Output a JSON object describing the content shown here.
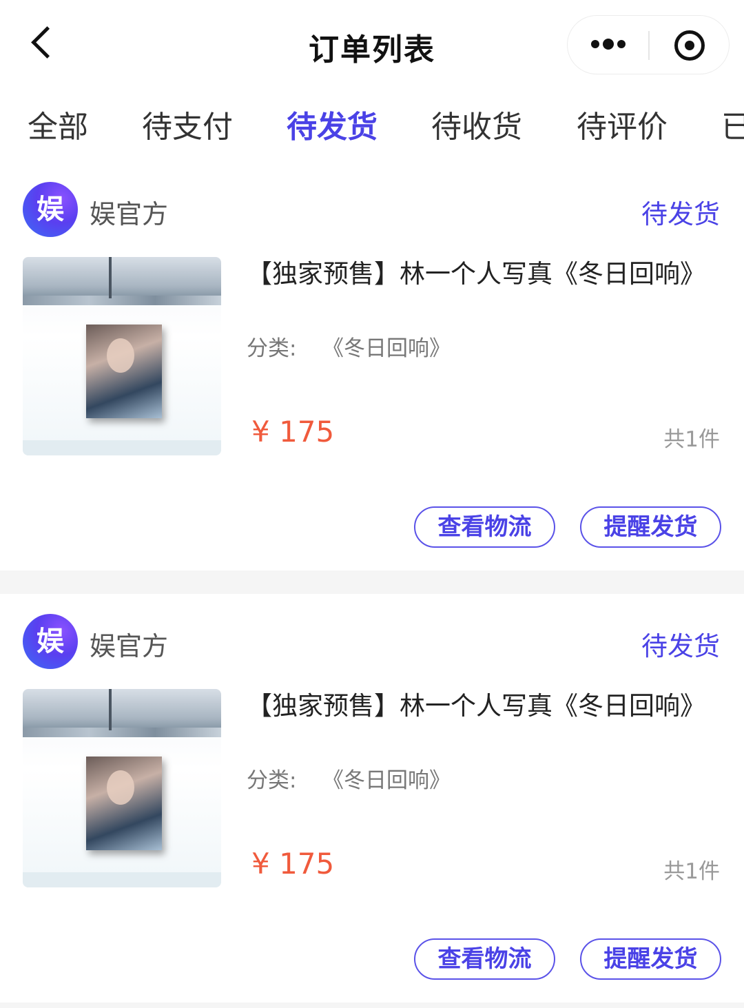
{
  "nav": {
    "title": "订单列表"
  },
  "tabs": [
    {
      "label": "全部",
      "active": false
    },
    {
      "label": "待支付",
      "active": false
    },
    {
      "label": "待发货",
      "active": true
    },
    {
      "label": "待收货",
      "active": false
    },
    {
      "label": "待评价",
      "active": false
    },
    {
      "label": "已",
      "active": false
    }
  ],
  "orders": [
    {
      "shop_logo_text": "娱",
      "shop_name": "娱官方",
      "status": "待发货",
      "product_title": "【独家预售】林一个人写真《冬日回响》",
      "spec_label": "分类:",
      "spec_value": "《冬日回响》",
      "price": "¥ 175",
      "count": "共1件",
      "btn_logistics": "查看物流",
      "btn_remind": "提醒发货"
    },
    {
      "shop_logo_text": "娱",
      "shop_name": "娱官方",
      "status": "待发货",
      "product_title": "【独家预售】林一个人写真《冬日回响》",
      "spec_label": "分类:",
      "spec_value": "《冬日回响》",
      "price": "¥ 175",
      "count": "共1件",
      "btn_logistics": "查看物流",
      "btn_remind": "提醒发货"
    }
  ],
  "colors": {
    "accent": "#4a42e6",
    "price": "#f05a3c",
    "divider": "#f5f5f5"
  }
}
